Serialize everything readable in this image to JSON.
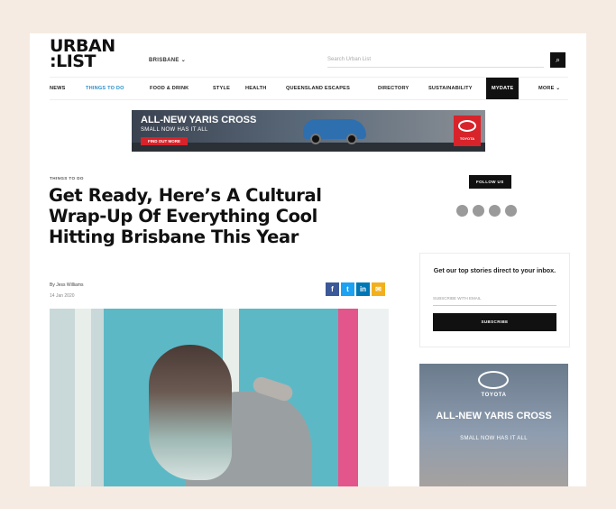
{
  "header": {
    "logo_line1": "URBAN",
    "logo_line2": ":LIST",
    "region": "BRISBANE ⌄",
    "search_placeholder": "Search Urban List"
  },
  "nav": [
    "NEWS",
    "THINGS TO DO",
    "FOOD & DRINK",
    "STYLE",
    "HEALTH",
    "QUEENSLAND ESCAPES",
    "DIRECTORY",
    "SUSTAINABILITY",
    "MYDATE",
    "MORE ⌄"
  ],
  "banner": {
    "headline": "ALL-NEW YARIS CROSS",
    "sub": "SMALL NOW HAS IT ALL",
    "cta": "FIND OUT MORE",
    "brand": "TOYOTA"
  },
  "article": {
    "kicker": "THINGS TO DO",
    "title": "Get Ready, Here’s A Cultural Wrap-Up Of Everything Cool Hitting Brisbane This Year",
    "byline": "By Jess Williams",
    "date": "14 Jan 2020"
  },
  "share_icons": [
    {
      "glyph": "f",
      "name": "facebook-icon",
      "color": "#3b5998"
    },
    {
      "glyph": "t",
      "name": "twitter-icon",
      "color": "#1da1f2"
    },
    {
      "glyph": "in",
      "name": "linkedin-icon",
      "color": "#0077b5"
    },
    {
      "glyph": "✉",
      "name": "email-icon",
      "color": "#f2b01e"
    }
  ],
  "sidebar": {
    "follow_label": "FOLLOW US",
    "social_icons": [
      "facebook-icon",
      "instagram-icon",
      "twitter-icon",
      "pinterest-icon"
    ],
    "subscribe": {
      "title": "Get our top stories direct to your inbox.",
      "input_placeholder": "SUBSCRIBE WITH EMAIL",
      "button": "SUBSCRIBE"
    },
    "ad": {
      "brand": "TOYOTA",
      "headline": "ALL-NEW YARIS CROSS",
      "sub": "SMALL NOW HAS IT ALL"
    }
  }
}
